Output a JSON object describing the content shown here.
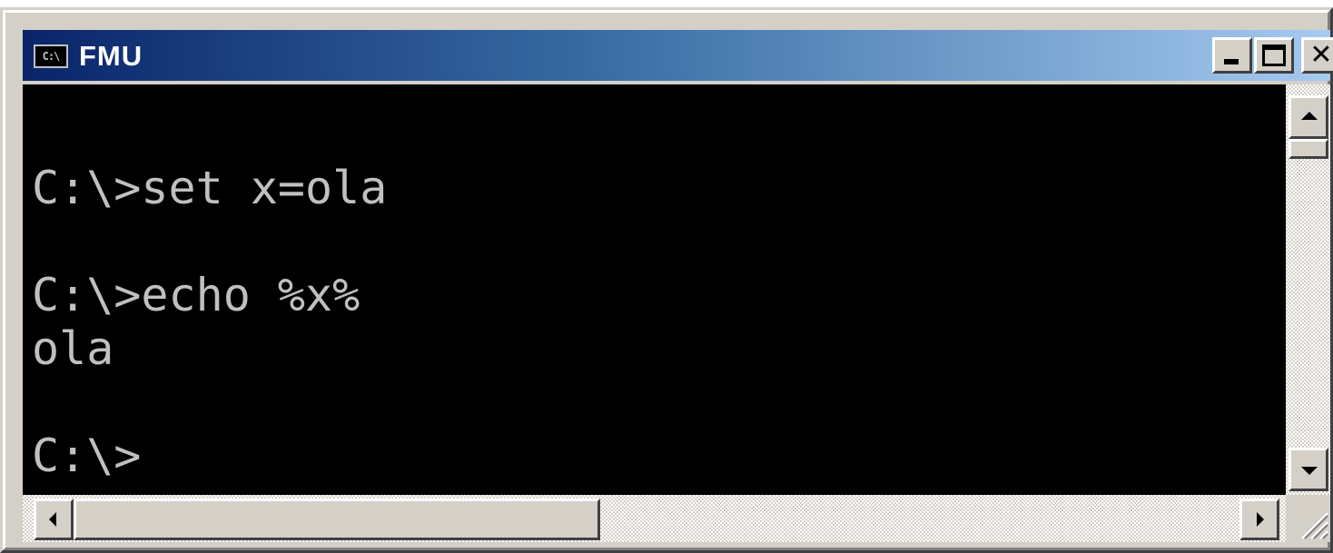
{
  "window": {
    "title": "FMU",
    "icon": "console-icon",
    "icon_text": "C:\\",
    "title_gradient": [
      "#0a246a",
      "#a6caf0"
    ]
  },
  "controls": {
    "minimize_icon": "minimize-icon",
    "maximize_icon": "maximize-icon",
    "close_icon": "close-icon",
    "close_glyph": "✕"
  },
  "console": {
    "background": "#000000",
    "foreground": "#c0c0c0",
    "lines": [
      "",
      "C:\\>set x=ola",
      "",
      "C:\\>echo %x%",
      "ola",
      "",
      "C:\\>"
    ]
  },
  "scrollbars": {
    "vertical_position": 0,
    "horizontal_visible_fraction": 0.43
  }
}
